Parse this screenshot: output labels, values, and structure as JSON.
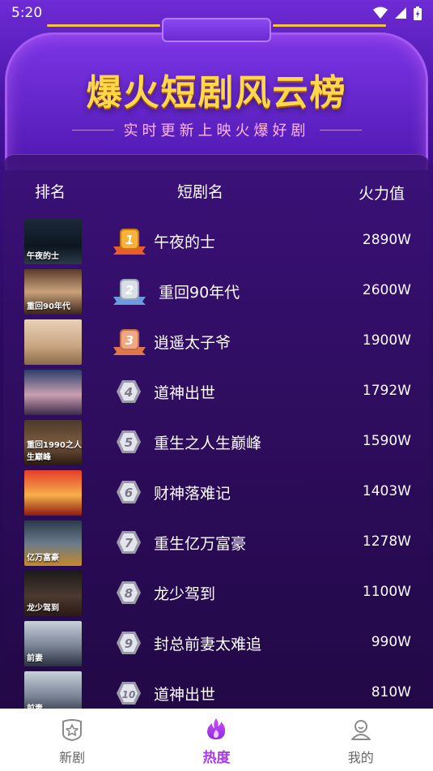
{
  "status_bar": {
    "time": "5:20"
  },
  "banner": {
    "title": "爆火短剧风云榜",
    "subtitle": "实时更新上映火爆好剧"
  },
  "table": {
    "headers": {
      "rank": "排名",
      "name": "短剧名",
      "heat": "火力值"
    },
    "rows": [
      {
        "rank": "1",
        "name": "午夜的士",
        "heat": "2890W",
        "poster_caption": "午夜的士",
        "medal": "gold"
      },
      {
        "rank": "2",
        "name": "重回90年代",
        "heat": "2600W",
        "poster_caption": "重回90年代",
        "medal": "silver"
      },
      {
        "rank": "3",
        "name": "逍遥太子爷",
        "heat": "1900W",
        "poster_caption": "",
        "medal": "bronze"
      },
      {
        "rank": "4",
        "name": "道神出世",
        "heat": "1792W",
        "poster_caption": "",
        "medal": "none"
      },
      {
        "rank": "5",
        "name": "重生之人生巅峰",
        "heat": "1590W",
        "poster_caption": "重回1990之人生巅峰",
        "medal": "none"
      },
      {
        "rank": "6",
        "name": "财神落难记",
        "heat": "1403W",
        "poster_caption": "",
        "medal": "none"
      },
      {
        "rank": "7",
        "name": "重生亿万富豪",
        "heat": "1278W",
        "poster_caption": "亿万富豪",
        "medal": "none"
      },
      {
        "rank": "8",
        "name": "龙少驾到",
        "heat": "1100W",
        "poster_caption": "龙少驾到",
        "medal": "none"
      },
      {
        "rank": "9",
        "name": "封总前妻太难追",
        "heat": "990W",
        "poster_caption": "前妻",
        "medal": "none"
      },
      {
        "rank": "10",
        "name": "道神出世",
        "heat": "810W",
        "poster_caption": "前妻",
        "medal": "none"
      }
    ]
  },
  "bottom_nav": {
    "items": [
      {
        "label": "新剧",
        "icon": "star-shield-icon",
        "active": false
      },
      {
        "label": "热度",
        "icon": "flame-icon",
        "active": true
      },
      {
        "label": "我的",
        "icon": "user-icon",
        "active": false
      }
    ]
  },
  "colors": {
    "accent": "#a63de8",
    "title_gold": "#ffd84a",
    "background": "#2a0b5e"
  }
}
